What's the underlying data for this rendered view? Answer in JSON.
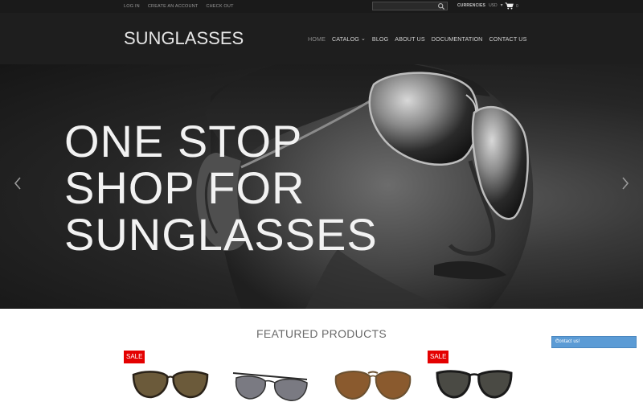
{
  "topbar": {
    "links": [
      "LOG IN",
      "CREATE AN ACCOUNT",
      "CHECK OUT"
    ],
    "search": {
      "value": "",
      "placeholder": ""
    },
    "currencies_label": "CURRENCIES",
    "currency_value": "USD",
    "cart_count": "0"
  },
  "header": {
    "logo": "SUNGLASSES",
    "nav": [
      "HOME",
      "CATALOG",
      "BLOG",
      "ABOUT US",
      "DOCUMENTATION",
      "CONTACT US"
    ]
  },
  "hero": {
    "lines": [
      "ONE STOP",
      "SHOP FOR",
      "SUNGLASSES"
    ]
  },
  "featured": {
    "title": "FEATURED PRODUCTS",
    "sale_label": "SALE"
  },
  "contact_widget": {
    "label": "Contact us!"
  },
  "colors": {
    "topbar_bg": "#1a1a1a",
    "header_bg": "#1e1e1e",
    "sale_badge": "#e40000",
    "contact_widget": "#5b9bd5"
  }
}
